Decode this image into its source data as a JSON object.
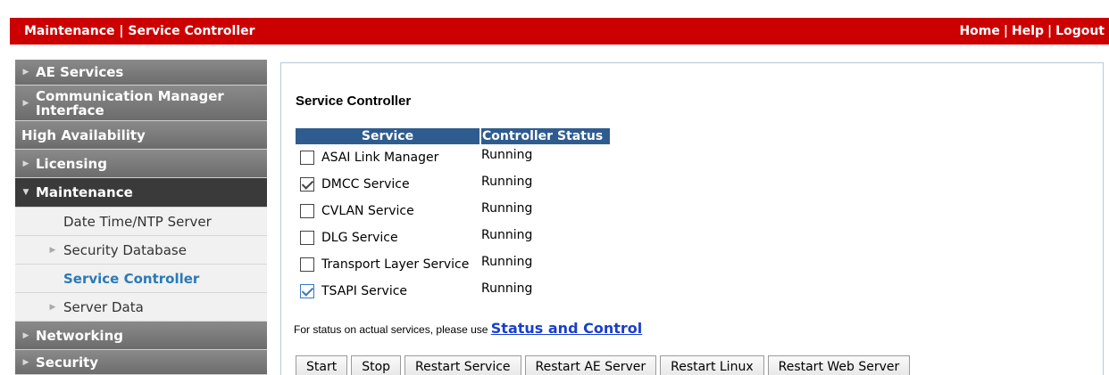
{
  "header": {
    "title": "Maintenance | Service Controller",
    "links": [
      "Home",
      "Help",
      "Logout"
    ],
    "separator": "|"
  },
  "sidebar": {
    "items": [
      {
        "label": "AE Services",
        "arrow": "right"
      },
      {
        "label": "Communication Manager Interface",
        "line1": "Communication Manager",
        "line2": "Interface",
        "arrow": "right"
      },
      {
        "label": "High Availability",
        "arrow": "none"
      },
      {
        "label": "Licensing",
        "arrow": "right"
      },
      {
        "label": "Maintenance",
        "arrow": "down",
        "expanded": true
      },
      {
        "label": "Networking",
        "arrow": "right"
      },
      {
        "label": "Security",
        "arrow": "right"
      }
    ],
    "subitems": [
      {
        "label": "Date Time/NTP Server",
        "arrow": "none"
      },
      {
        "label": "Security Database",
        "arrow": "right"
      },
      {
        "label": "Service Controller",
        "arrow": "none",
        "active": true
      },
      {
        "label": "Server Data",
        "arrow": "right"
      }
    ]
  },
  "main": {
    "heading": "Service Controller",
    "table": {
      "headers": [
        "Service",
        "Controller Status"
      ],
      "rows": [
        {
          "service": "ASAI Link Manager",
          "status": "Running",
          "checked": false
        },
        {
          "service": "DMCC Service",
          "status": "Running",
          "checked": true
        },
        {
          "service": "CVLAN Service",
          "status": "Running",
          "checked": false
        },
        {
          "service": "DLG Service",
          "status": "Running",
          "checked": false
        },
        {
          "service": "Transport Layer Service",
          "status": "Running",
          "checked": false
        },
        {
          "service": "TSAPI Service",
          "status": "Running",
          "checked": true
        }
      ]
    },
    "note_text": "For status on actual services, please use ",
    "note_link": "Status and Control",
    "buttons": [
      "Start",
      "Stop",
      "Restart Service",
      "Restart AE Server",
      "Restart Linux",
      "Restart Web Server"
    ]
  },
  "colors": {
    "header_red": "#cc0000",
    "table_header_blue": "#2f5c8f",
    "active_link_blue": "#2a7ab8",
    "link_blue": "#1a3fcc"
  },
  "icons": {
    "collapsed": "triangle-right-icon",
    "expanded": "triangle-down-icon",
    "checkbox": "checkbox-icon"
  }
}
